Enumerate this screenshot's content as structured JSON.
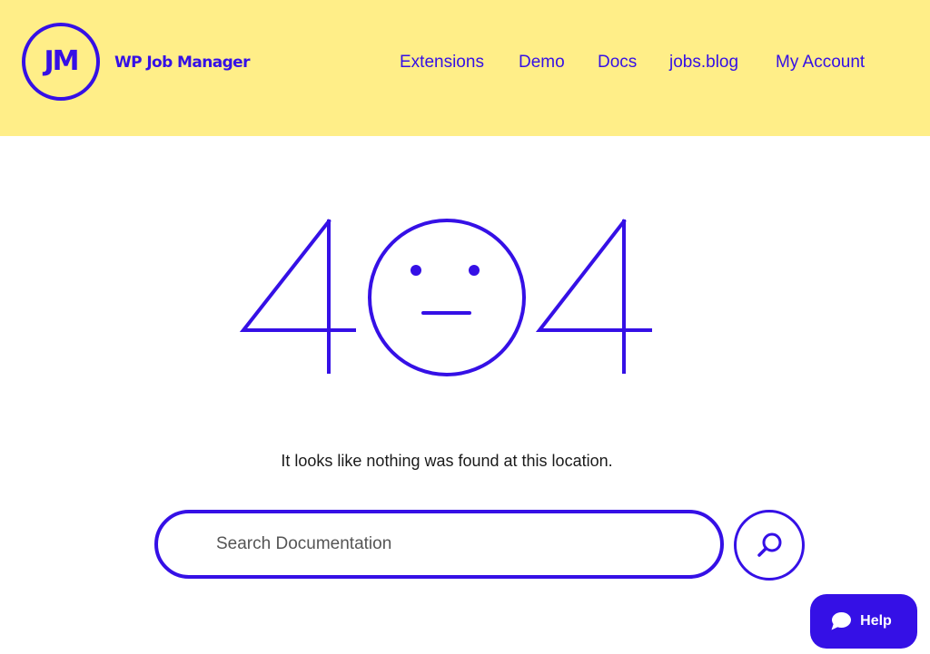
{
  "brand": {
    "logo_mark": "JM",
    "name": "WP Job Manager"
  },
  "nav": {
    "items": [
      {
        "label": "Extensions"
      },
      {
        "label": "Demo"
      },
      {
        "label": "Docs"
      },
      {
        "label": "jobs.blog"
      },
      {
        "label": "My Account"
      }
    ]
  },
  "error": {
    "code": "404",
    "message": "It looks like nothing was found at this location."
  },
  "search": {
    "placeholder": "Search Documentation",
    "button_icon": "search-icon"
  },
  "help": {
    "label": "Help",
    "icon": "chat-bubble-icon"
  },
  "colors": {
    "accent": "#3510e6",
    "header_background": "#ffee88",
    "page_background": "#ffffff",
    "text": "#1a1a1a"
  }
}
